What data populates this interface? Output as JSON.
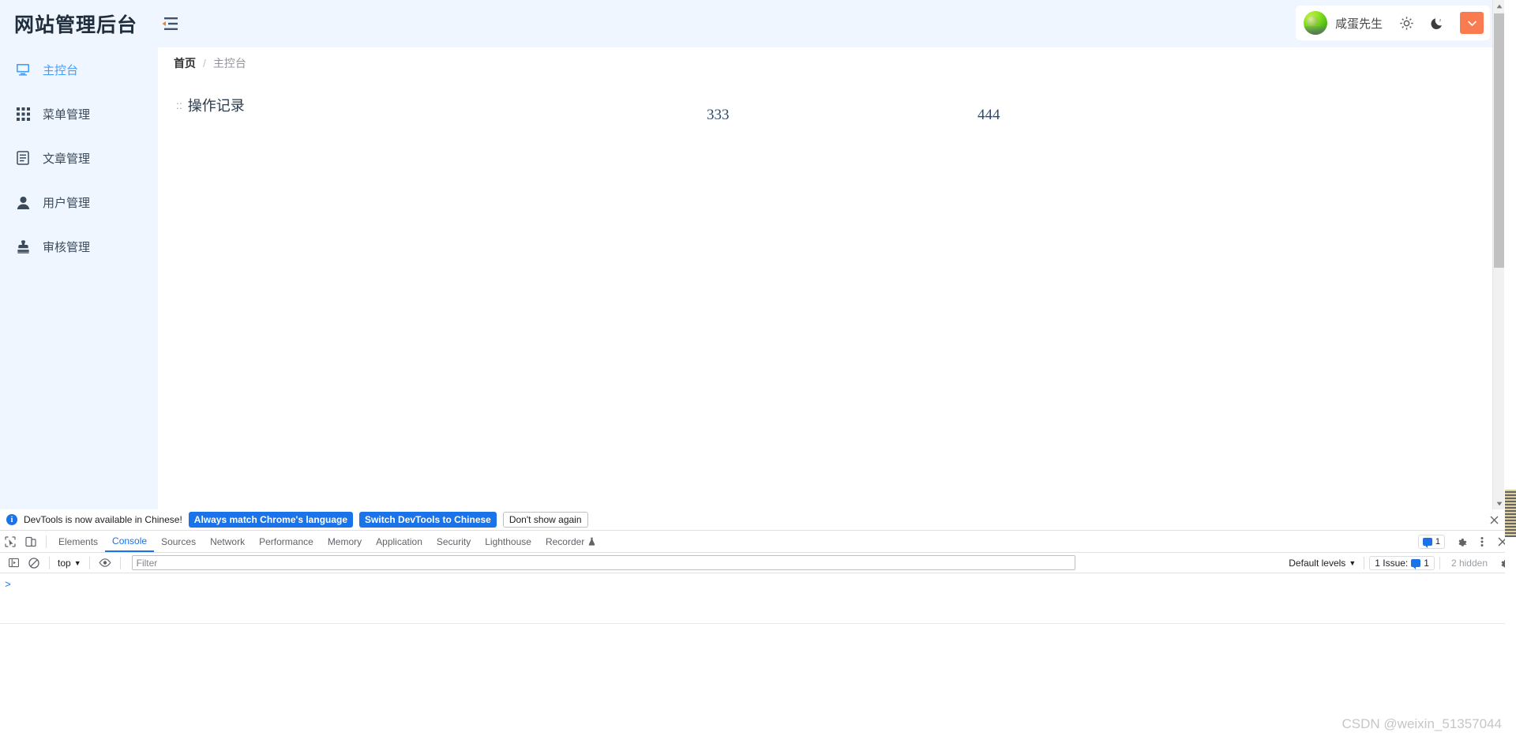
{
  "app": {
    "brand_title": "网站管理后台",
    "fold_icon": "menu-fold-icon"
  },
  "header": {
    "username": "咸蛋先生",
    "avatar_alt": "user-avatar",
    "settings_icon": "gear-sun-icon",
    "dark_mode_icon": "moon-icon",
    "dropdown_icon": "chevron-down-icon",
    "accent_color": "#f97b4f"
  },
  "sidebar": {
    "items": [
      {
        "label": "主控台",
        "icon": "monitor-icon",
        "active": true
      },
      {
        "label": "菜单管理",
        "icon": "grid-icon",
        "active": false
      },
      {
        "label": "文章管理",
        "icon": "document-icon",
        "active": false
      },
      {
        "label": "用户管理",
        "icon": "user-icon",
        "active": false
      },
      {
        "label": "审核管理",
        "icon": "stamp-icon",
        "active": false
      }
    ]
  },
  "breadcrumb": {
    "home": "首页",
    "separator": "/",
    "current": "主控台"
  },
  "main": {
    "panel_dots": "::",
    "panel_title": "操作记录",
    "stat_a": "333",
    "stat_b": "444"
  },
  "devtools": {
    "notice": {
      "info_icon": "info-icon",
      "text": "DevTools is now available in Chinese!",
      "btn_always": "Always match Chrome's language",
      "btn_switch": "Switch DevTools to Chinese",
      "btn_dismiss": "Don't show again",
      "close_icon": "close-icon",
      "primary_color": "#1a73e8"
    },
    "tabs": {
      "inspect_icon": "inspect-element-icon",
      "device_icon": "device-toolbar-icon",
      "items": [
        {
          "label": "Elements",
          "active": false
        },
        {
          "label": "Console",
          "active": true
        },
        {
          "label": "Sources",
          "active": false
        },
        {
          "label": "Network",
          "active": false
        },
        {
          "label": "Performance",
          "active": false
        },
        {
          "label": "Memory",
          "active": false
        },
        {
          "label": "Application",
          "active": false
        },
        {
          "label": "Security",
          "active": false
        },
        {
          "label": "Lighthouse",
          "active": false
        },
        {
          "label": "Recorder",
          "active": false
        }
      ],
      "recorder_badge_icon": "experiment-icon",
      "message_count": "1",
      "message_icon": "speech-bubble-icon",
      "settings_icon": "gear-icon",
      "more_icon": "kebab-menu-icon",
      "close_icon": "close-icon"
    },
    "console_bar": {
      "sidebar_icon": "console-sidebar-icon",
      "clear_icon": "clear-console-icon",
      "context": "top",
      "context_caret": "▼",
      "eye_icon": "live-expression-icon",
      "filter_placeholder": "Filter",
      "filter_value": "",
      "levels_label": "Default levels",
      "levels_caret": "▼",
      "issues_label": "1 Issue:",
      "issues_count": "1",
      "issues_icon": "speech-bubble-icon",
      "hidden_label": "2 hidden",
      "settings_icon": "gear-icon"
    },
    "console": {
      "prompt": ">"
    }
  },
  "watermark": "CSDN @weixin_51357044"
}
